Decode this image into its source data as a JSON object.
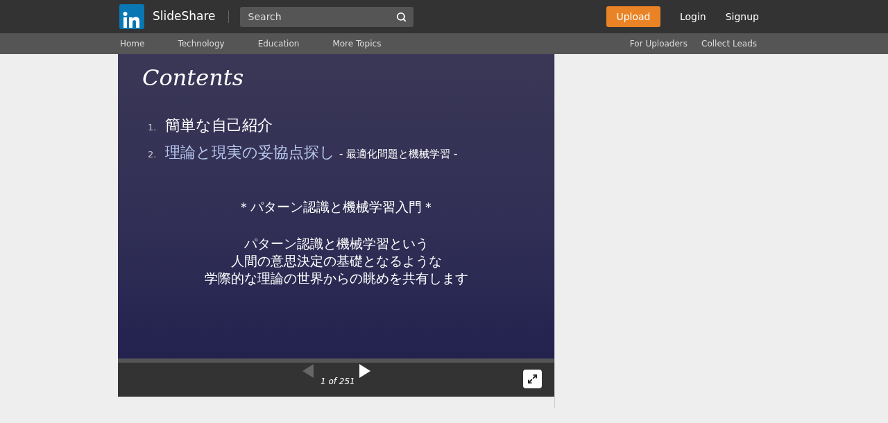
{
  "header": {
    "brand": "SlideShare",
    "search": {
      "placeholder": "Search"
    },
    "upload": "Upload",
    "links": [
      "Login",
      "Signup"
    ]
  },
  "nav": {
    "left": [
      "Home",
      "Technology",
      "Education",
      "More Topics"
    ],
    "right": [
      "For Uploaders",
      "Collect Leads"
    ]
  },
  "slide": {
    "title": "Contents",
    "items": [
      {
        "number": "1.",
        "text": "簡単な自己紹介"
      },
      {
        "number": "2.",
        "text": "理論と現実の妥協点探し",
        "sub": "- 最適化問題と機械学習 -"
      }
    ],
    "heading": "＊パターン認識と機械学習入門＊",
    "body": [
      "パターン認識と機械学習という",
      "人間の意思決定の基礎となるような",
      "学際的な理論の世界からの眺めを共有します"
    ]
  },
  "player": {
    "prev": {
      "disabled": true
    },
    "next": {
      "disabled": false
    },
    "counter": "1 of 251"
  }
}
